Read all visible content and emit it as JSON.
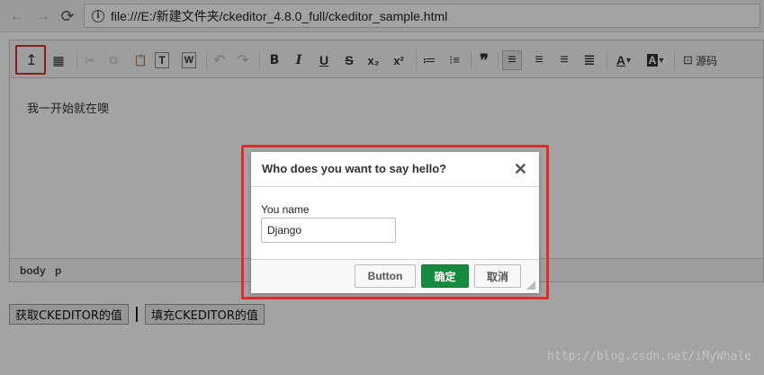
{
  "browser": {
    "url": "file:///E:/新建文件夹/ckeditor_4.8.0_full/ckeditor_sample.html",
    "back_glyph": "←",
    "forward_glyph": "→",
    "reload_glyph": "⟳",
    "info_glyph": "i"
  },
  "toolbar": {
    "icons": {
      "addon": "↥",
      "table": "▦",
      "cut": "✂",
      "copy": "⧉",
      "paste": "📋",
      "paste_text": "T",
      "paste_word": "W",
      "undo": "↶",
      "redo": "↷",
      "bold": "B",
      "italic": "I",
      "underline": "U",
      "strike": "S",
      "subscript": "x₂",
      "superscript": "x²",
      "numbered_list": "≔",
      "bulleted_list": "⁝≡",
      "blockquote": "❞",
      "align_left": "≡",
      "align_center": "≡",
      "align_right": "≡",
      "justify": "≣",
      "text_color": "A",
      "bg_color": "A",
      "dropdown": "▾",
      "source": "⊡"
    },
    "source_label": "源码"
  },
  "editor": {
    "content_text": "我一开始就在噢",
    "path": [
      "body",
      "p"
    ]
  },
  "page_buttons": {
    "get_value": "获取CKEDITOR的值",
    "set_value": "填充CKEDITOR的值"
  },
  "dialog": {
    "title": "Who does you want to say hello?",
    "close_glyph": "✕",
    "field_label": "You name",
    "field_value": "Django",
    "button_plain": "Button",
    "button_ok": "确定",
    "button_cancel": "取消"
  },
  "watermark": "http://blog.csdn.net/iMyWhale",
  "colors": {
    "highlight": "#e52a2a",
    "ok_green": "#168a3f"
  }
}
